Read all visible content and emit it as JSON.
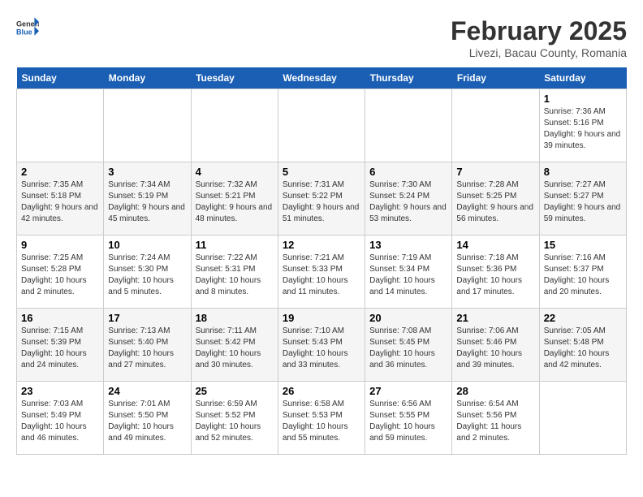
{
  "app": {
    "name_general": "General",
    "name_blue": "Blue"
  },
  "calendar": {
    "title": "February 2025",
    "subtitle": "Livezi, Bacau County, Romania"
  },
  "weekdays": [
    "Sunday",
    "Monday",
    "Tuesday",
    "Wednesday",
    "Thursday",
    "Friday",
    "Saturday"
  ],
  "weeks": [
    [
      {
        "day": "",
        "info": ""
      },
      {
        "day": "",
        "info": ""
      },
      {
        "day": "",
        "info": ""
      },
      {
        "day": "",
        "info": ""
      },
      {
        "day": "",
        "info": ""
      },
      {
        "day": "",
        "info": ""
      },
      {
        "day": "1",
        "info": "Sunrise: 7:36 AM\nSunset: 5:16 PM\nDaylight: 9 hours and 39 minutes."
      }
    ],
    [
      {
        "day": "2",
        "info": "Sunrise: 7:35 AM\nSunset: 5:18 PM\nDaylight: 9 hours and 42 minutes."
      },
      {
        "day": "3",
        "info": "Sunrise: 7:34 AM\nSunset: 5:19 PM\nDaylight: 9 hours and 45 minutes."
      },
      {
        "day": "4",
        "info": "Sunrise: 7:32 AM\nSunset: 5:21 PM\nDaylight: 9 hours and 48 minutes."
      },
      {
        "day": "5",
        "info": "Sunrise: 7:31 AM\nSunset: 5:22 PM\nDaylight: 9 hours and 51 minutes."
      },
      {
        "day": "6",
        "info": "Sunrise: 7:30 AM\nSunset: 5:24 PM\nDaylight: 9 hours and 53 minutes."
      },
      {
        "day": "7",
        "info": "Sunrise: 7:28 AM\nSunset: 5:25 PM\nDaylight: 9 hours and 56 minutes."
      },
      {
        "day": "8",
        "info": "Sunrise: 7:27 AM\nSunset: 5:27 PM\nDaylight: 9 hours and 59 minutes."
      }
    ],
    [
      {
        "day": "9",
        "info": "Sunrise: 7:25 AM\nSunset: 5:28 PM\nDaylight: 10 hours and 2 minutes."
      },
      {
        "day": "10",
        "info": "Sunrise: 7:24 AM\nSunset: 5:30 PM\nDaylight: 10 hours and 5 minutes."
      },
      {
        "day": "11",
        "info": "Sunrise: 7:22 AM\nSunset: 5:31 PM\nDaylight: 10 hours and 8 minutes."
      },
      {
        "day": "12",
        "info": "Sunrise: 7:21 AM\nSunset: 5:33 PM\nDaylight: 10 hours and 11 minutes."
      },
      {
        "day": "13",
        "info": "Sunrise: 7:19 AM\nSunset: 5:34 PM\nDaylight: 10 hours and 14 minutes."
      },
      {
        "day": "14",
        "info": "Sunrise: 7:18 AM\nSunset: 5:36 PM\nDaylight: 10 hours and 17 minutes."
      },
      {
        "day": "15",
        "info": "Sunrise: 7:16 AM\nSunset: 5:37 PM\nDaylight: 10 hours and 20 minutes."
      }
    ],
    [
      {
        "day": "16",
        "info": "Sunrise: 7:15 AM\nSunset: 5:39 PM\nDaylight: 10 hours and 24 minutes."
      },
      {
        "day": "17",
        "info": "Sunrise: 7:13 AM\nSunset: 5:40 PM\nDaylight: 10 hours and 27 minutes."
      },
      {
        "day": "18",
        "info": "Sunrise: 7:11 AM\nSunset: 5:42 PM\nDaylight: 10 hours and 30 minutes."
      },
      {
        "day": "19",
        "info": "Sunrise: 7:10 AM\nSunset: 5:43 PM\nDaylight: 10 hours and 33 minutes."
      },
      {
        "day": "20",
        "info": "Sunrise: 7:08 AM\nSunset: 5:45 PM\nDaylight: 10 hours and 36 minutes."
      },
      {
        "day": "21",
        "info": "Sunrise: 7:06 AM\nSunset: 5:46 PM\nDaylight: 10 hours and 39 minutes."
      },
      {
        "day": "22",
        "info": "Sunrise: 7:05 AM\nSunset: 5:48 PM\nDaylight: 10 hours and 42 minutes."
      }
    ],
    [
      {
        "day": "23",
        "info": "Sunrise: 7:03 AM\nSunset: 5:49 PM\nDaylight: 10 hours and 46 minutes."
      },
      {
        "day": "24",
        "info": "Sunrise: 7:01 AM\nSunset: 5:50 PM\nDaylight: 10 hours and 49 minutes."
      },
      {
        "day": "25",
        "info": "Sunrise: 6:59 AM\nSunset: 5:52 PM\nDaylight: 10 hours and 52 minutes."
      },
      {
        "day": "26",
        "info": "Sunrise: 6:58 AM\nSunset: 5:53 PM\nDaylight: 10 hours and 55 minutes."
      },
      {
        "day": "27",
        "info": "Sunrise: 6:56 AM\nSunset: 5:55 PM\nDaylight: 10 hours and 59 minutes."
      },
      {
        "day": "28",
        "info": "Sunrise: 6:54 AM\nSunset: 5:56 PM\nDaylight: 11 hours and 2 minutes."
      },
      {
        "day": "",
        "info": ""
      }
    ]
  ]
}
